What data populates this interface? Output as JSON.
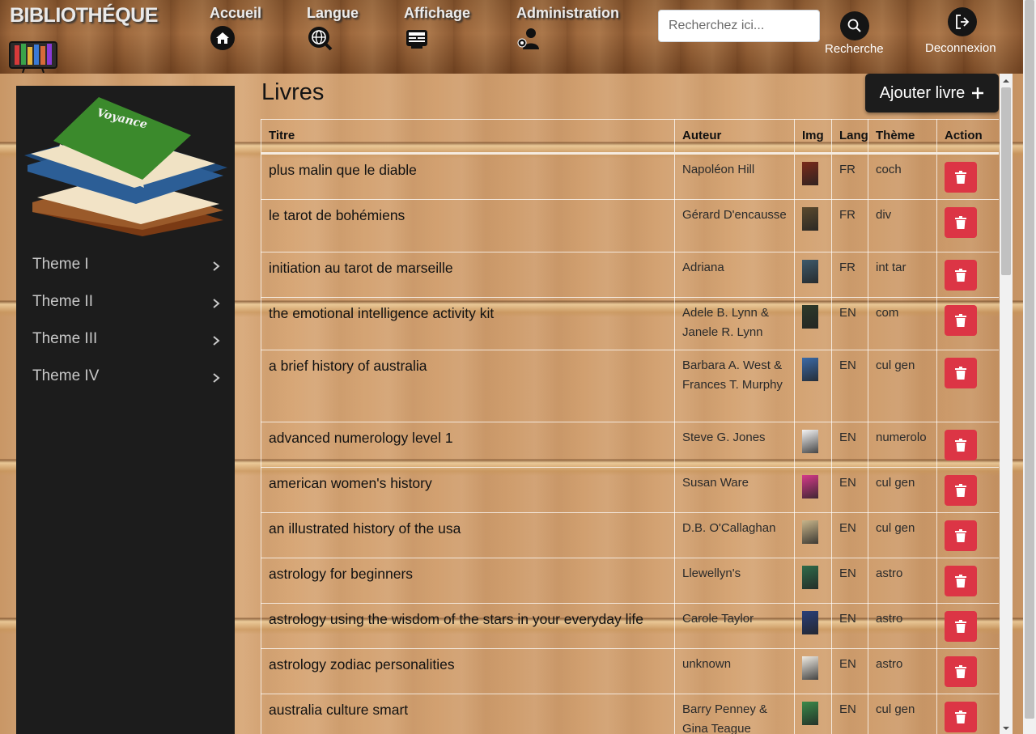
{
  "header": {
    "brand": "BIBLIOTHÉQUE",
    "nav": [
      {
        "label": "Accueil",
        "icon": "home-icon"
      },
      {
        "label": "Langue",
        "icon": "globe-icon"
      },
      {
        "label": "Affichage",
        "icon": "display-icon"
      },
      {
        "label": "Administration",
        "icon": "admin-icon"
      }
    ],
    "search_placeholder": "Recherchez ici...",
    "search_label": "Recherche",
    "logout_label": "Deconnexion"
  },
  "sidebar": {
    "cover_text": "Voyance",
    "items": [
      {
        "label": "Theme I"
      },
      {
        "label": "Theme II"
      },
      {
        "label": "Theme III"
      },
      {
        "label": "Theme IV"
      }
    ]
  },
  "main": {
    "title": "Livres",
    "add_button": "Ajouter livre",
    "columns": [
      "Titre",
      "Auteur",
      "Img",
      "Lang",
      "Thème",
      "Action"
    ],
    "rows": [
      {
        "titre": "plus malin que le diable",
        "auteur": "Napoléon Hill",
        "lang": "FR",
        "theme": "coch",
        "thumb": "#7a2a1a"
      },
      {
        "titre": "le tarot de bohémiens",
        "auteur": "Gérard D'encausse",
        "lang": "FR",
        "theme": "div",
        "thumb": "#5b4a2e"
      },
      {
        "titre": "initiation au tarot de marseille",
        "auteur": "Adriana",
        "lang": "FR",
        "theme": "int tar",
        "thumb": "#3e5a6b"
      },
      {
        "titre": "the emotional intelligence activity kit",
        "auteur": "Adele B. Lynn & Janele R. Lynn",
        "lang": "EN",
        "theme": "com",
        "thumb": "#2d3a2a"
      },
      {
        "titre": "a brief history of australia",
        "auteur": "Barbara A. West & Frances T. Murphy",
        "lang": "EN",
        "theme": "cul gen",
        "thumb": "#3b6aa8"
      },
      {
        "titre": "advanced numerology level 1",
        "auteur": "Steve G. Jones",
        "lang": "EN",
        "theme": "numerolo",
        "thumb": "#f4f4f4"
      },
      {
        "titre": "american women's history",
        "auteur": "Susan Ware",
        "lang": "EN",
        "theme": "cul gen",
        "thumb": "#d63a8a"
      },
      {
        "titre": "an illustrated history of the usa",
        "auteur": "D.B. O'Callaghan",
        "lang": "EN",
        "theme": "cul gen",
        "thumb": "#c8b58a"
      },
      {
        "titre": "astrology for beginners",
        "auteur": "Llewellyn's",
        "lang": "EN",
        "theme": "astro",
        "thumb": "#2f6b4a"
      },
      {
        "titre": "astrology using the wisdom of the stars in your everyday life",
        "auteur": "Carole Taylor",
        "lang": "EN",
        "theme": "astro",
        "thumb": "#2a3f7a"
      },
      {
        "titre": "astrology zodiac personalities",
        "auteur": "unknown",
        "lang": "EN",
        "theme": "astro",
        "thumb": "#f0ece4"
      },
      {
        "titre": "australia culture smart",
        "auteur": "Barry Penney & Gina Teague",
        "lang": "EN",
        "theme": "cul gen",
        "thumb": "#3a8a4a"
      }
    ]
  },
  "colors": {
    "delete": "#dc3545",
    "sidebar": "#1c1c1c"
  }
}
